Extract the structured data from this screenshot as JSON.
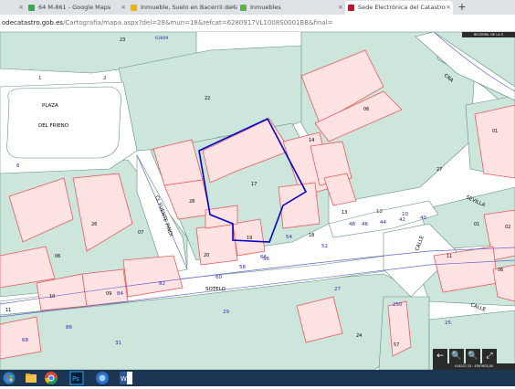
{
  "browser": {
    "tabs": [
      {
        "label": "",
        "active": false
      },
      {
        "label": "64 M-861 - Google Maps",
        "active": false
      },
      {
        "label": "Inmueble, Suelo en Bacerril de la S",
        "active": false
      },
      {
        "label": "Inmuebles",
        "active": false
      },
      {
        "label": "Sede Electrónica del Catastro",
        "active": true
      }
    ],
    "new_tab": "+",
    "close_glyph": "×",
    "url_host": "odecatastro.gob.es",
    "url_path": "/Cartografia/mapa.aspx?del=28&mun=18&refcat=6280917VL1008S0001BB&final="
  },
  "map": {
    "scale_label": "BECERRIL DE LA S",
    "coordinates": "414237,15 : 4507603,00",
    "labels": {
      "plaza": "PLAZA",
      "del_frieno": "DEL FRIENO",
      "cl_fuente_pindi": "CL FUENTE PINDI",
      "sotelo": "SOTELO",
      "calle1": "CALLE",
      "calle2": "CALLE",
      "sevilla": "SEVILLA",
      "cra": "CRA"
    },
    "parcel_numbers": [
      "23",
      "22",
      "17",
      "06",
      "27",
      "28",
      "26",
      "07",
      "06",
      "10",
      "09",
      "11",
      "20",
      "19",
      "18",
      "14",
      "13",
      "01",
      "11",
      "24",
      "57",
      "06",
      "01",
      "02"
    ],
    "street_numbers": [
      "1",
      "2",
      "6",
      "66",
      "60",
      "58",
      "56",
      "54",
      "52",
      "48",
      "46",
      "44",
      "42",
      "40",
      "84",
      "82",
      "86",
      "31",
      "29",
      "27",
      "250",
      "25",
      "26",
      "12",
      "10",
      "68"
    ],
    "block_code": "63809",
    "toolbar": [
      "←",
      "🔍",
      "🔍",
      "⤢"
    ]
  },
  "colors": {
    "tabbar": "#dee1e6",
    "parcel_fill": "#ffe3e3",
    "parcel_border": "#e85a5a",
    "block_fill": "#cde6dc",
    "road_line": "#5555cc",
    "selected": "#0000d0",
    "taskbar": "#1c3553"
  },
  "taskbar": {
    "items": [
      "start-icon",
      "chrome-icon",
      "photoshop-icon",
      "media-icon",
      "word-icon"
    ]
  }
}
